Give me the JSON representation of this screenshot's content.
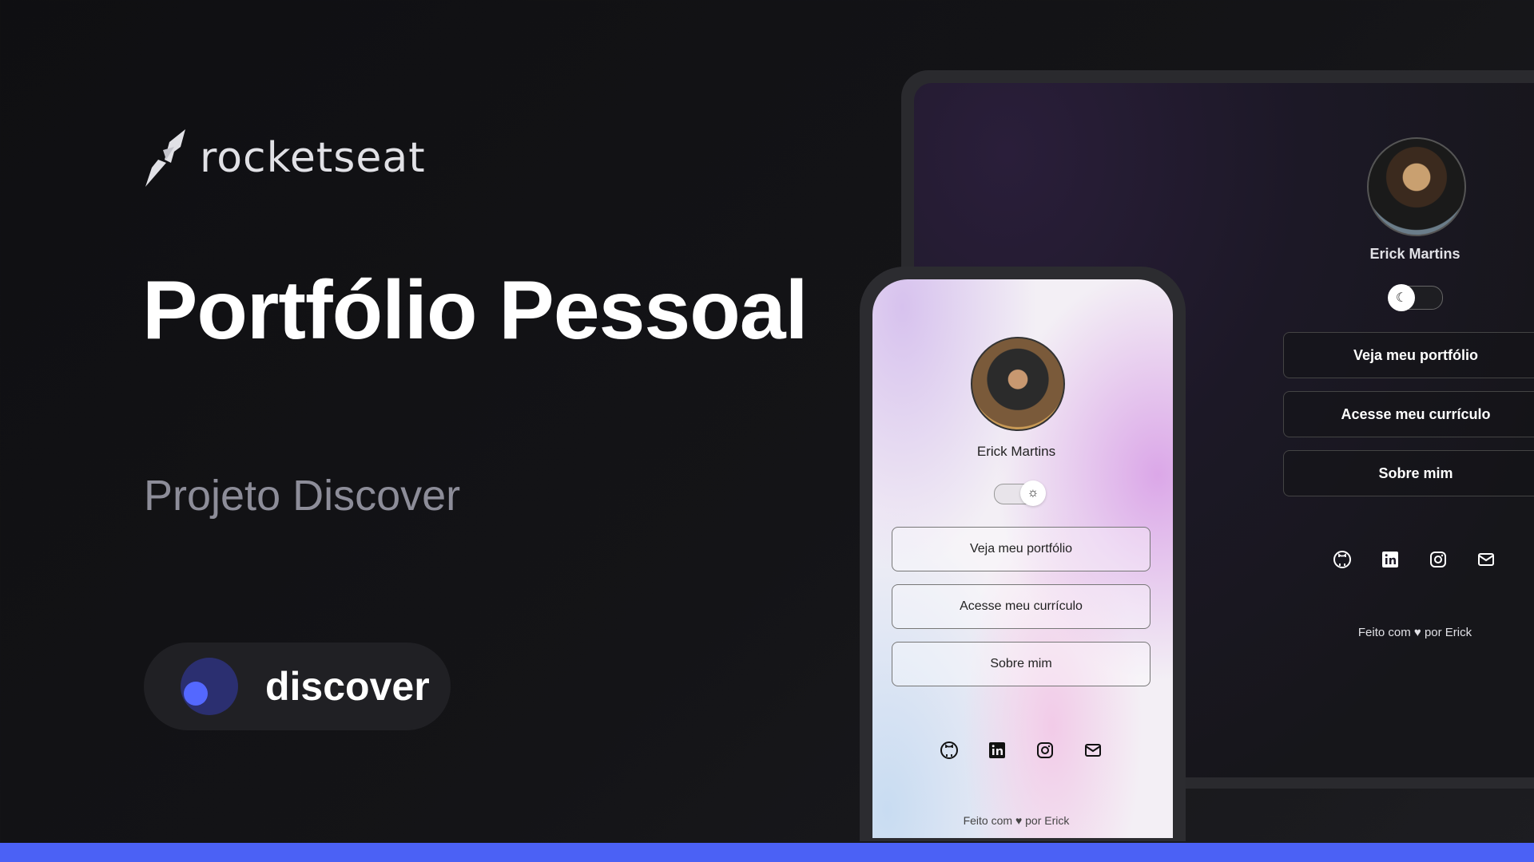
{
  "brand": {
    "name": "rocketseat"
  },
  "hero": {
    "title": "Portfólio Pessoal",
    "subtitle": "Projeto Discover",
    "badge_label": "discover"
  },
  "colors": {
    "accent": "#4b61f5",
    "background": "#121214",
    "pill_bg": "#202024"
  },
  "desktop_preview": {
    "name": "Erick Martins",
    "theme_toggle_icon": "moon-icon",
    "buttons": [
      "Veja meu portfólio",
      "Acesse meu currículo",
      "Sobre mim"
    ],
    "social_icons": [
      "github-icon",
      "linkedin-icon",
      "instagram-icon",
      "mail-icon"
    ],
    "footer": "Feito com ♥ por Erick"
  },
  "mobile_preview": {
    "name": "Erick Martins",
    "theme_toggle_icon": "sun-icon",
    "buttons": [
      "Veja meu portfólio",
      "Acesse meu currículo",
      "Sobre mim"
    ],
    "social_icons": [
      "github-icon",
      "linkedin-icon",
      "instagram-icon",
      "mail-icon"
    ],
    "footer": "Feito com ♥ por Erick"
  }
}
